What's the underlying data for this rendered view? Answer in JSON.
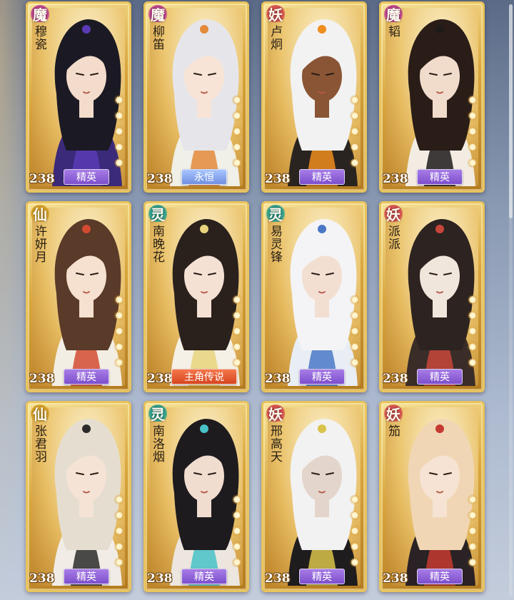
{
  "colors": {
    "faction": {
      "魔": "#c1448f",
      "妖": "#d9534f",
      "仙": "#d8a227",
      "灵": "#33a48f"
    },
    "quality": {
      "精英": "linear-gradient(180deg,#a77ce6,#7d4fcc)",
      "永恒": "linear-gradient(180deg,#a9c6ff,#6f8fe0)",
      "主角传说": "linear-gradient(180deg,#f5764a,#d6451f)"
    }
  },
  "cards": [
    {
      "faction": "魔",
      "name": "穆瓷",
      "level": "238",
      "quality": "精英",
      "stars": 5,
      "art": {
        "hair": "#1b1a24",
        "accent": "#5a3bb5",
        "skin": "#f3dccb",
        "robe": "#3b2a7a"
      }
    },
    {
      "faction": "魔",
      "name": "柳笛",
      "level": "238",
      "quality": "永恒",
      "stars": 5,
      "art": {
        "hair": "#e6e6ea",
        "accent": "#e38a3b",
        "skin": "#f7e4d6",
        "robe": "#f0efe8"
      }
    },
    {
      "faction": "妖",
      "name": "卢炯",
      "level": "238",
      "quality": "精英",
      "stars": 5,
      "art": {
        "hair": "#f2f2f2",
        "accent": "#ef8d1f",
        "skin": "#8a5535",
        "robe": "#2a2420"
      }
    },
    {
      "faction": "魔",
      "name": "韬",
      "level": "238",
      "quality": "精英",
      "stars": 5,
      "art": {
        "hair": "#2a1d18",
        "accent": "#1f1b1b",
        "skin": "#f1dccc",
        "robe": "#f2ece2"
      }
    },
    {
      "faction": "仙",
      "name": "许妍月",
      "level": "238",
      "quality": "精英",
      "stars": 5,
      "art": {
        "hair": "#5a3a28",
        "accent": "#d44b32",
        "skin": "#f6e0cf",
        "robe": "#f3eee4"
      }
    },
    {
      "faction": "灵",
      "name": "南晚花",
      "level": "238",
      "quality": "主角传说",
      "stars": 5,
      "art": {
        "hair": "#2a211d",
        "accent": "#e8d37c",
        "skin": "#f5e1d4",
        "robe": "#f6f1e6"
      }
    },
    {
      "faction": "灵",
      "name": "易灵锋",
      "level": "238",
      "quality": "精英",
      "stars": 5,
      "art": {
        "hair": "#f4f4f6",
        "accent": "#4a78c7",
        "skin": "#f2dfd2",
        "robe": "#e9eef5"
      }
    },
    {
      "faction": "妖",
      "name": "派派",
      "level": "238",
      "quality": "精英",
      "stars": 5,
      "art": {
        "hair": "#2d2320",
        "accent": "#c9463a",
        "skin": "#f0e6dc",
        "robe": "#3a2d28"
      }
    },
    {
      "faction": "仙",
      "name": "张君羽",
      "level": "238",
      "quality": "精英",
      "stars": 5,
      "art": {
        "hair": "#e5ded0",
        "accent": "#2b2b2b",
        "skin": "#f5e3d6",
        "robe": "#f1ede6"
      }
    },
    {
      "faction": "灵",
      "name": "南洛烟",
      "level": "238",
      "quality": "精英",
      "stars": 5,
      "art": {
        "hair": "#1e1b1e",
        "accent": "#48c1c7",
        "skin": "#f1dcd0",
        "robe": "#ece6df"
      }
    },
    {
      "faction": "妖",
      "name": "邢高天",
      "level": "238",
      "quality": "精英",
      "stars": 5,
      "art": {
        "hair": "#f2f2f2",
        "accent": "#d9c34a",
        "skin": "#e4d5cc",
        "robe": "#1f1c1e"
      }
    },
    {
      "faction": "妖",
      "name": "笳",
      "level": "238",
      "quality": "精英",
      "stars": 5,
      "art": {
        "hair": "#f0d6b4",
        "accent": "#c43a30",
        "skin": "#f6e3d3",
        "robe": "#2a2224"
      }
    }
  ]
}
